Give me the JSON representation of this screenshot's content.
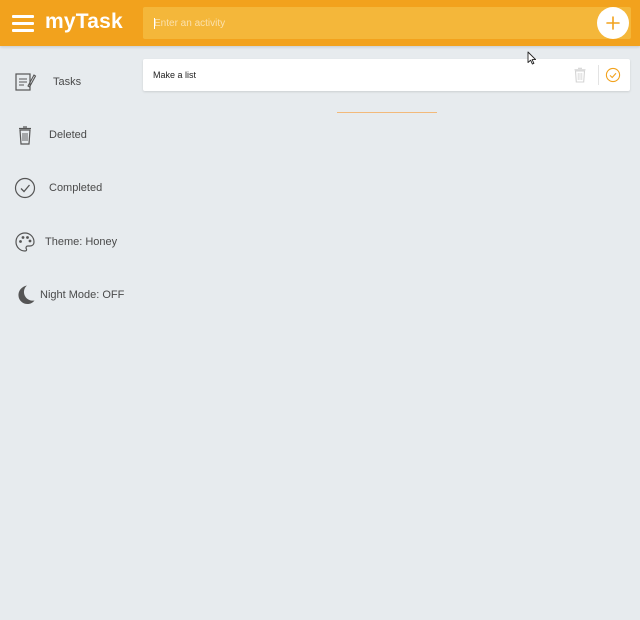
{
  "header": {
    "logo": "myTask",
    "search_placeholder": "Enter an activity",
    "search_value": "",
    "add_icon": "plus-icon",
    "menu_icon": "hamburger-menu-icon"
  },
  "sidebar": {
    "items": [
      {
        "label": "Tasks",
        "icon": "tasks-icon"
      },
      {
        "label": "Deleted",
        "icon": "trash-icon"
      },
      {
        "label": "Completed",
        "icon": "check-circle-icon"
      },
      {
        "label": "Theme: Honey",
        "icon": "palette-icon"
      },
      {
        "label": "Night Mode: OFF",
        "icon": "moon-icon"
      }
    ]
  },
  "tasks": [
    {
      "text": "Make a list",
      "delete_icon": "trash-icon",
      "complete_icon": "check-circle-icon"
    }
  ],
  "colors": {
    "accent": "#f2a21d",
    "background": "#e7ebee",
    "card": "#ffffff",
    "text": "#4a4a4a"
  }
}
